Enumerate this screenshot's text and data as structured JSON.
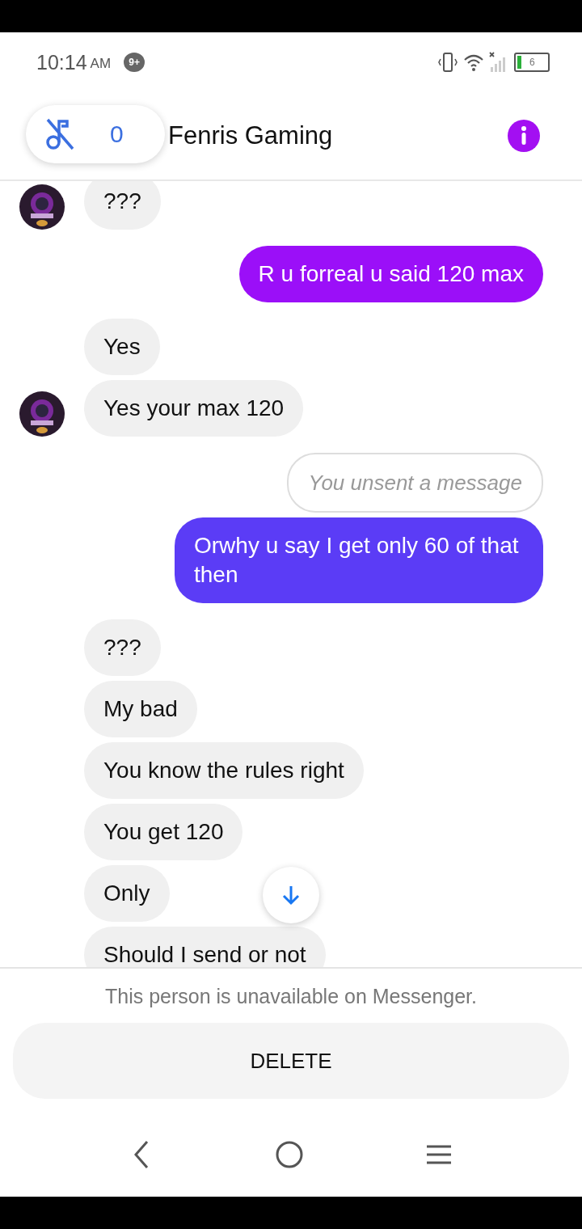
{
  "status_bar": {
    "time": "10:14",
    "meridiem": "AM",
    "notification_badge": "9+",
    "battery": "6"
  },
  "overlay_bubble": {
    "count": "0"
  },
  "header": {
    "title": "Fenris Gaming"
  },
  "messages": [
    {
      "kind": "incoming",
      "text": "???",
      "avatar": true
    },
    {
      "kind": "outgoing",
      "text": "R u forreal u said 120 max",
      "color": "#9b0ff8"
    },
    {
      "kind": "incoming",
      "text": "Yes",
      "avatar": false
    },
    {
      "kind": "incoming",
      "text": "Yes your max 120",
      "avatar": true
    },
    {
      "kind": "unsent",
      "text": "You unsent a message"
    },
    {
      "kind": "outgoing",
      "text": "Orwhy u say I get only 60 of that then",
      "color": "#5b3cf6"
    },
    {
      "kind": "incoming",
      "text": "???",
      "avatar": false
    },
    {
      "kind": "incoming",
      "text": "My bad",
      "avatar": false
    },
    {
      "kind": "incoming",
      "text": "You know the rules right",
      "avatar": false
    },
    {
      "kind": "incoming",
      "text": "You get 120",
      "avatar": false
    },
    {
      "kind": "incoming",
      "text": "Only",
      "avatar": false
    },
    {
      "kind": "incoming",
      "text": "Should I send or not",
      "avatar": false
    }
  ],
  "footer": {
    "notice": "This person is unavailable on Messenger.",
    "button": "DELETE"
  }
}
